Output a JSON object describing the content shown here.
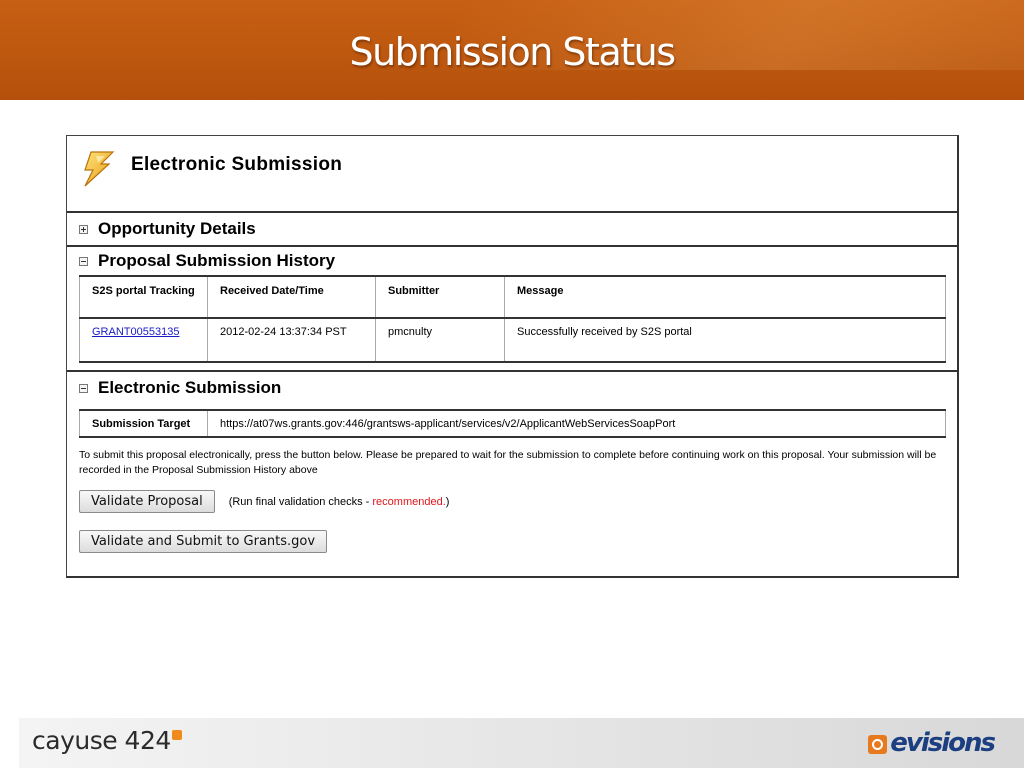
{
  "slide": {
    "title": "Submission Status"
  },
  "panel": {
    "header_title": "Electronic Submission"
  },
  "sections": {
    "opportunity": {
      "title": "Opportunity Details",
      "state": "collapsed"
    },
    "history": {
      "title": "Proposal Submission History",
      "state": "expanded",
      "columns": [
        "S2S portal Tracking",
        "Received Date/Time",
        "Submitter",
        "Message"
      ],
      "rows": [
        {
          "tracking": "GRANT00553135",
          "received": "2012-02-24 13:37:34 PST",
          "submitter": "pmcnulty",
          "message": "Successfully received by S2S portal"
        }
      ]
    },
    "electronic": {
      "title": "Electronic Submission",
      "state": "expanded",
      "target_label": "Submission Target",
      "target_value": "https://at07ws.grants.gov:446/grantsws-applicant/services/v2/ApplicantWebServicesSoapPort",
      "instructions": "To submit this proposal electronically, press the button below. Please be prepared to wait for the submission to complete before continuing work on this proposal. Your submission will be recorded in the Proposal Submission History above",
      "validate_button": "Validate Proposal",
      "hint_prefix": "(Run final validation checks - ",
      "hint_recommended": "recommended.",
      "hint_suffix": ")",
      "submit_button": "Validate and Submit to Grants.gov"
    }
  },
  "footer": {
    "left_brand": "cayuse 424",
    "right_brand": "evisions"
  },
  "colors": {
    "banner": "#c05a10",
    "link": "#1a1ac8",
    "recommended": "#e0161b",
    "cayuse_accent": "#f08a1c",
    "evisions_blue": "#1c3f82"
  },
  "icons": {
    "header": "lightning-bolt-icon",
    "opportunity_toggle": "expand-plus-icon",
    "history_toggle": "collapse-minus-icon",
    "electronic_toggle": "collapse-minus-icon"
  }
}
